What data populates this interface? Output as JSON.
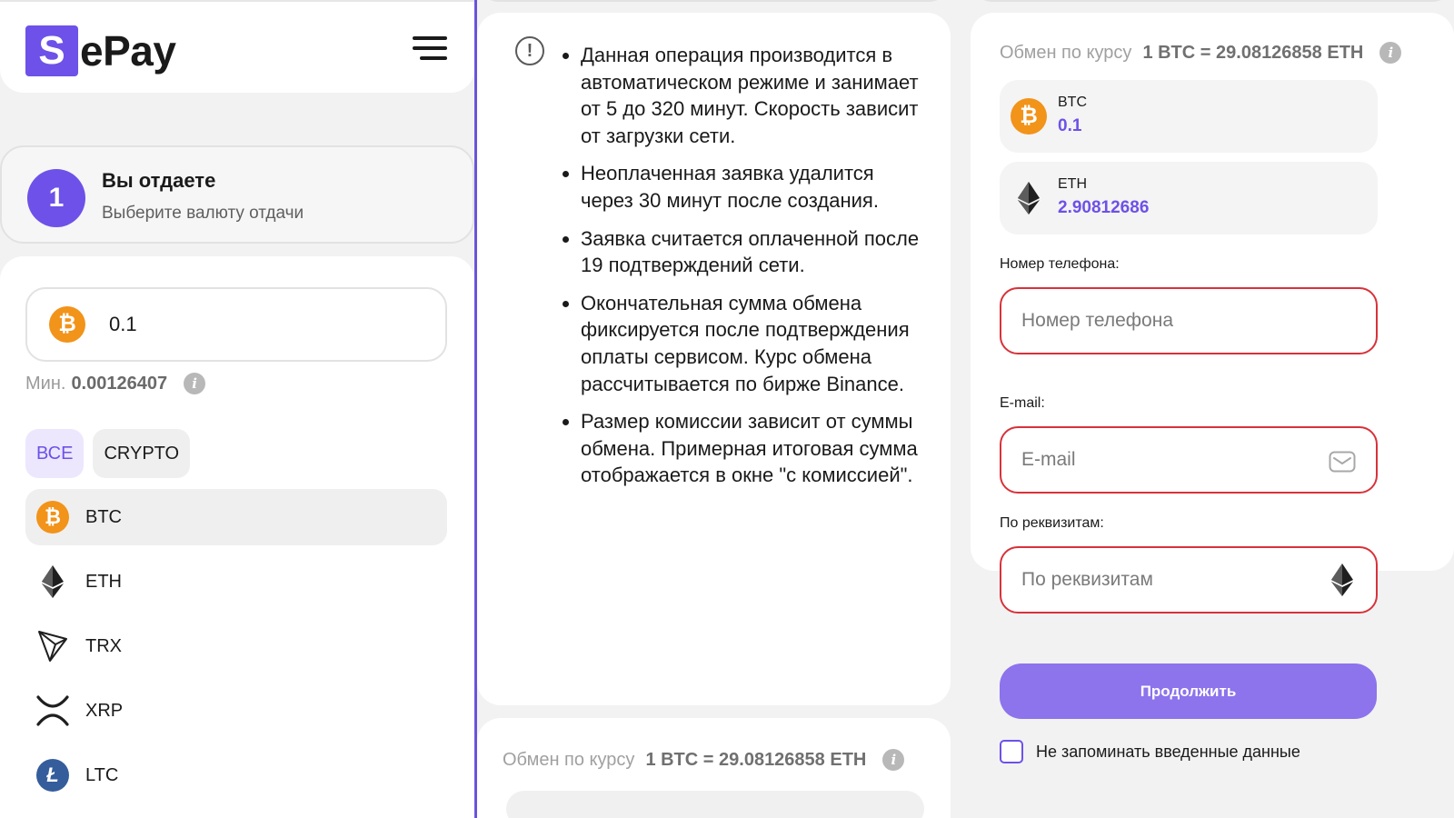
{
  "brand": {
    "logo_letter": "S",
    "logo_rest": "ePay"
  },
  "step": {
    "number": "1",
    "title": "Вы отдаете",
    "subtitle": "Выберите валюту отдачи"
  },
  "give": {
    "amount": "0.1",
    "min_label": "Мин.",
    "min_value": "0.00126407",
    "filters": [
      {
        "label": "ВСЕ",
        "active": true
      },
      {
        "label": "CRYPTO",
        "active": false
      }
    ],
    "coins": [
      {
        "code": "BTC",
        "icon": "bitcoin-icon",
        "selected": true
      },
      {
        "code": "ETH",
        "icon": "ethereum-icon",
        "selected": false
      },
      {
        "code": "TRX",
        "icon": "tron-icon",
        "selected": false
      },
      {
        "code": "XRP",
        "icon": "ripple-icon",
        "selected": false
      },
      {
        "code": "LTC",
        "icon": "litecoin-icon",
        "selected": false
      }
    ]
  },
  "notes": [
    "Данная операция производится в автоматическом режиме и занимает от 5 до 320 минут. Скорость зависит от загрузки сети.",
    "Неоплаченная заявка удалится через 30 минут после создания.",
    "Заявка считается оплаченной после 19 подтверждений сети.",
    "Окончательная сумма обмена фиксируется после подтверждения оплаты сервисом. Курс обмена рассчитывается по бирже Binance.",
    "Размер комиссии зависит от суммы обмена. Примерная итоговая сумма отображается в окне \"с комиссией\"."
  ],
  "rate": {
    "label": "Обмен по курсу",
    "value": "1 BTC = 29.08126858 ETH"
  },
  "pair": {
    "from": {
      "code": "BTC",
      "amount": "0.1"
    },
    "to": {
      "code": "ETH",
      "amount": "2.90812686"
    }
  },
  "form": {
    "phone": {
      "label": "Номер телефона:",
      "placeholder": "Номер телефона"
    },
    "email": {
      "label": "E-mail:",
      "placeholder": "E-mail"
    },
    "requisites": {
      "label": "По реквизитам:",
      "placeholder": "По реквизитам"
    },
    "continue_label": "Продолжить",
    "remember_label": "Не запоминать введенные данные"
  },
  "colors": {
    "accent": "#6e51e8",
    "button": "#8d73ec",
    "error_border": "#d8323a",
    "btc": "#f2931a",
    "ltc": "#355d9c"
  }
}
